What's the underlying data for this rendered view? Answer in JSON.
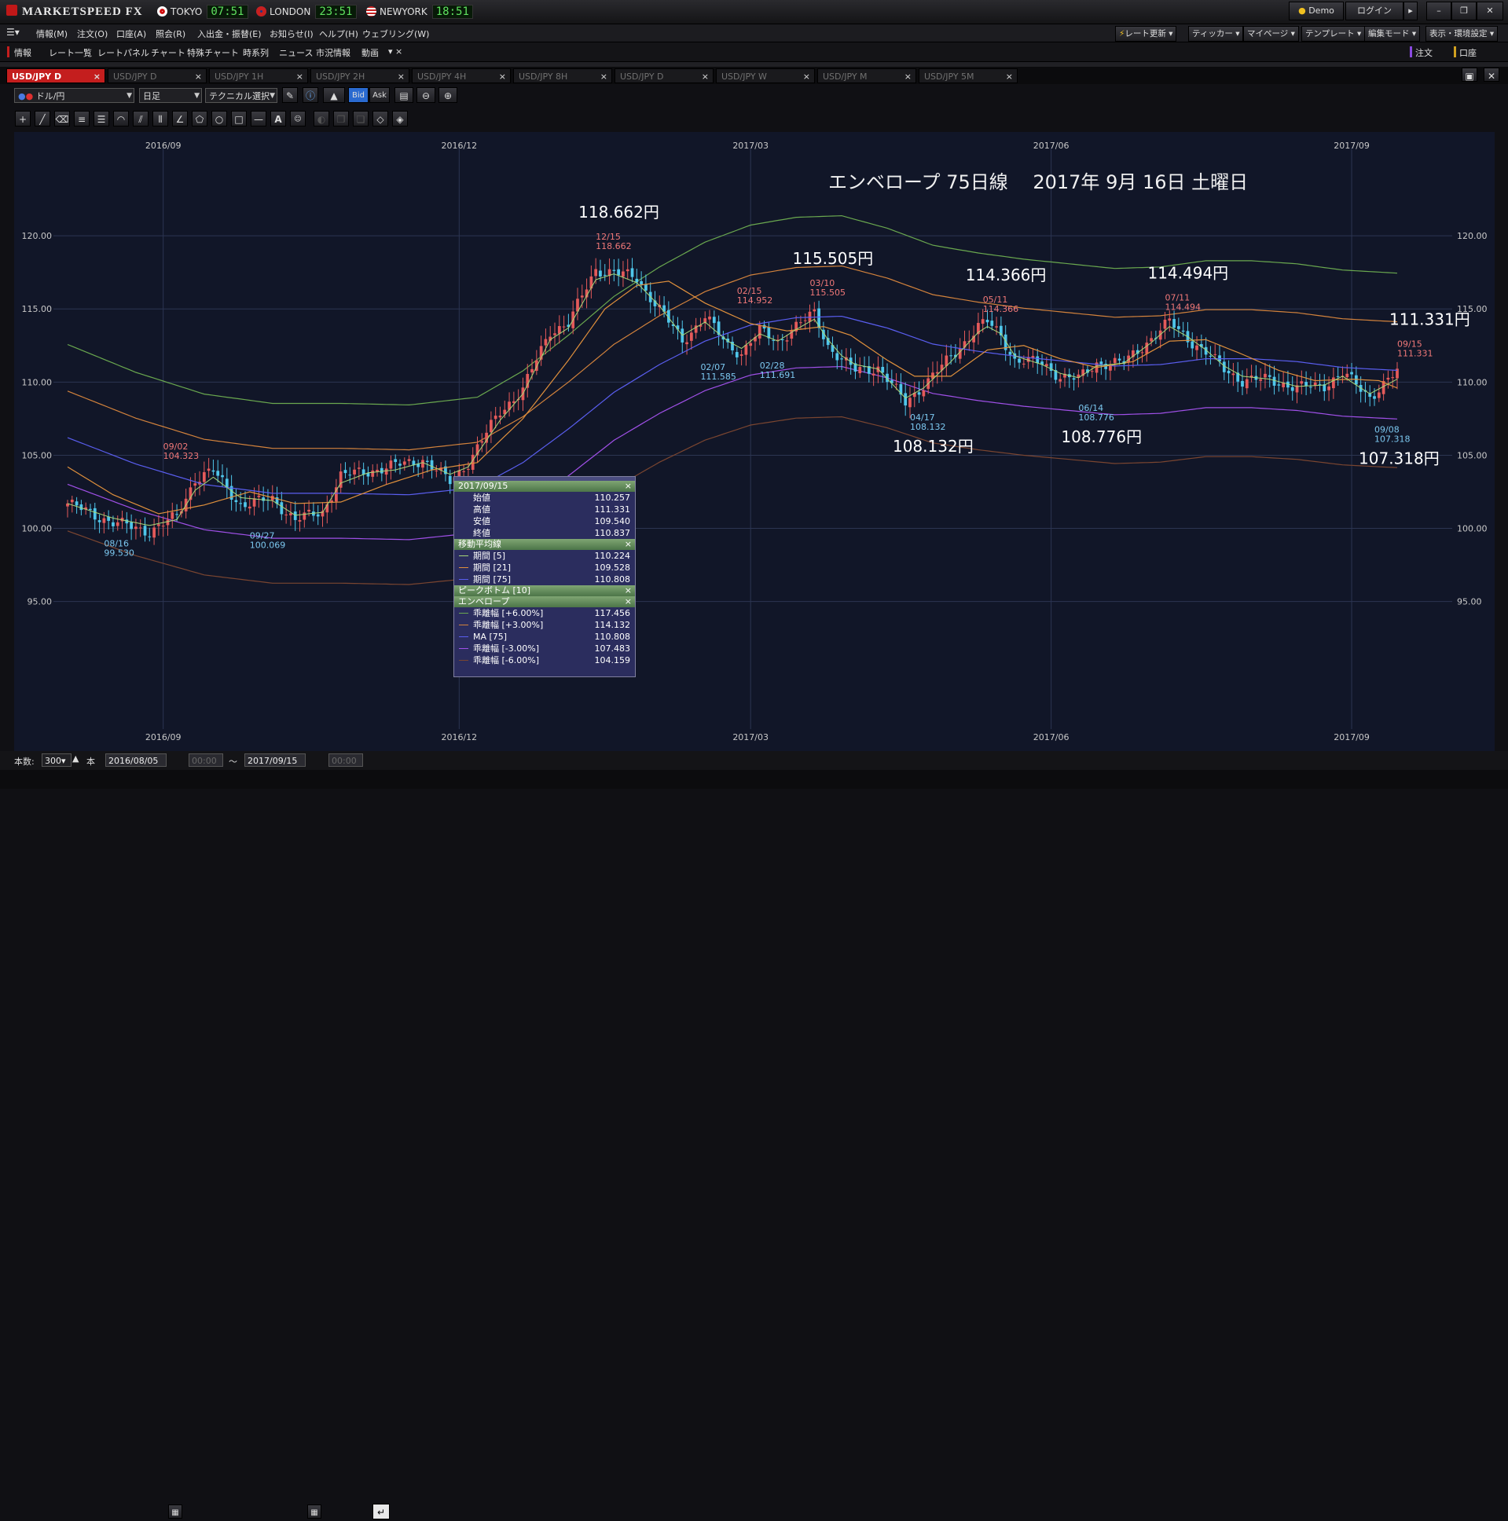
{
  "app": {
    "title": "MARKETSPEED FX",
    "markets": [
      {
        "name": "TOKYO",
        "time": "07:51",
        "flag_color": "#d01010"
      },
      {
        "name": "LONDON",
        "time": "23:51",
        "flag_color": "#1a3a8a"
      },
      {
        "name": "NEWYORK",
        "time": "18:51",
        "flag_color": "#2050a0"
      }
    ],
    "demo_label": "Demo",
    "login_label": "ログイン",
    "window_buttons": [
      "–",
      "❐",
      "✕"
    ]
  },
  "menu": {
    "items": [
      "情報(M)",
      "注文(O)",
      "口座(A)",
      "照会(R)",
      "入出金・振替(E)",
      "お知らせ(I)",
      "ヘルプ(H)",
      "ウェブリング(W)"
    ],
    "right_buttons": [
      "レート更新",
      "ティッカー",
      "マイページ",
      "テンプレート",
      "編集モード",
      "表示・環境設定"
    ]
  },
  "quickbar": {
    "items": [
      "情報",
      "レート一覧",
      "レートパネル",
      "チャート",
      "特殊チャート",
      "時系列",
      "ニュース",
      "市況情報",
      "動画"
    ],
    "right": [
      "注文",
      "口座"
    ]
  },
  "tabs": [
    {
      "label": "USD/JPY D",
      "active": true
    },
    {
      "label": "USD/JPY D"
    },
    {
      "label": "USD/JPY 1H"
    },
    {
      "label": "USD/JPY 2H"
    },
    {
      "label": "USD/JPY 4H"
    },
    {
      "label": "USD/JPY 8H"
    },
    {
      "label": "USD/JPY D"
    },
    {
      "label": "USD/JPY W"
    },
    {
      "label": "USD/JPY M"
    },
    {
      "label": "USD/JPY 5M"
    }
  ],
  "toolbar": {
    "pair": "ドル/円",
    "period": "日足",
    "technical": "テクニカル選択",
    "bid": "Bid",
    "ask": "Ask"
  },
  "chart_data": {
    "type": "candlestick",
    "title": "エンベロープ 75日線　 2017年 9月 16日 土曜日",
    "x_tick_labels": [
      "2016/09",
      "2016/12",
      "2017/03",
      "2017/06",
      "2017/09"
    ],
    "ylim": [
      93.8,
      122.8
    ],
    "y_ticks": [
      "95.00",
      "100.00",
      "105.00",
      "110.00",
      "115.00",
      "120.00"
    ],
    "grid": true,
    "colors": {
      "up": "#e45a5a",
      "down": "#4fc6ea",
      "ma5": "#a8d878",
      "ma21": "#e0903c",
      "ma75": "#5a5ef0",
      "env_p6": "#6aa84f",
      "env_p3": "#d2823c",
      "env_m3": "#a050e8",
      "env_m6": "#7a4530"
    },
    "peaks": [
      {
        "date": "12/15",
        "value": "118.662",
        "big": "118.662円",
        "type": "high"
      },
      {
        "date": "03/10",
        "value": "115.505",
        "big": "115.505円",
        "type": "high"
      },
      {
        "date": "05/11",
        "value": "114.366",
        "big": "114.366円",
        "type": "high"
      },
      {
        "date": "07/11",
        "value": "114.494",
        "big": "114.494円",
        "type": "high"
      },
      {
        "date": "09/15",
        "value": "111.331",
        "big": "111.331円",
        "type": "high"
      },
      {
        "date": "09/02",
        "value": "104.323",
        "type": "high"
      },
      {
        "date": "02/15",
        "value": "114.952",
        "type": "high"
      },
      {
        "date": "08/16",
        "value": "99.530",
        "type": "low"
      },
      {
        "date": "09/27",
        "value": "100.069",
        "type": "low"
      },
      {
        "date": "02/07",
        "value": "111.585",
        "type": "low"
      },
      {
        "date": "02/28",
        "value": "111.691",
        "type": "low"
      },
      {
        "date": "04/17",
        "value": "108.132",
        "big": "108.132円",
        "type": "low"
      },
      {
        "date": "06/14",
        "value": "108.776",
        "big": "108.776円",
        "type": "low"
      },
      {
        "date": "09/08",
        "value": "107.318",
        "big": "107.318円",
        "type": "low"
      }
    ],
    "series_anchors": {
      "close": [
        [
          0,
          101.7
        ],
        [
          10,
          100.4
        ],
        [
          18,
          99.8
        ],
        [
          24,
          100.8
        ],
        [
          28,
          103.4
        ],
        [
          32,
          103.9
        ],
        [
          38,
          101.6
        ],
        [
          45,
          102.0
        ],
        [
          50,
          100.6
        ],
        [
          56,
          101.1
        ],
        [
          60,
          103.6
        ],
        [
          66,
          103.9
        ],
        [
          72,
          104.3
        ],
        [
          78,
          104.7
        ],
        [
          84,
          103.2
        ],
        [
          88,
          104.5
        ],
        [
          95,
          108.0
        ],
        [
          100,
          109.5
        ],
        [
          106,
          113.5
        ],
        [
          110,
          114.0
        ],
        [
          116,
          117.7
        ],
        [
          120,
          117.5
        ],
        [
          125,
          117.1
        ],
        [
          130,
          115.0
        ],
        [
          135,
          112.8
        ],
        [
          140,
          114.5
        ],
        [
          145,
          112.5
        ],
        [
          148,
          112.0
        ],
        [
          152,
          113.5
        ],
        [
          156,
          112.8
        ],
        [
          160,
          113.8
        ],
        [
          164,
          114.7
        ],
        [
          167,
          112.5
        ],
        [
          170,
          111.5
        ],
        [
          173,
          110.8
        ],
        [
          178,
          111.0
        ],
        [
          184,
          108.6
        ],
        [
          188,
          109.8
        ],
        [
          194,
          111.7
        ],
        [
          200,
          113.8
        ],
        [
          202,
          114.1
        ],
        [
          205,
          113.2
        ],
        [
          208,
          111.5
        ],
        [
          214,
          111.3
        ],
        [
          218,
          110.4
        ],
        [
          222,
          110.2
        ],
        [
          226,
          111.3
        ],
        [
          232,
          111.3
        ],
        [
          238,
          113.0
        ],
        [
          242,
          114.1
        ],
        [
          246,
          113.0
        ],
        [
          250,
          112.0
        ],
        [
          254,
          110.9
        ],
        [
          258,
          110.1
        ],
        [
          264,
          110.2
        ],
        [
          270,
          109.6
        ],
        [
          276,
          109.8
        ],
        [
          280,
          110.6
        ],
        [
          286,
          109.0
        ],
        [
          292,
          110.7
        ]
      ]
    },
    "ma_anchors": {
      "ma5": [
        [
          0,
          101.7
        ],
        [
          10,
          100.7
        ],
        [
          18,
          100.2
        ],
        [
          24,
          100.6
        ],
        [
          28,
          102.6
        ],
        [
          32,
          103.5
        ],
        [
          38,
          102.1
        ],
        [
          45,
          101.9
        ],
        [
          50,
          100.9
        ],
        [
          56,
          101.1
        ],
        [
          60,
          103.1
        ],
        [
          66,
          103.8
        ],
        [
          72,
          104.0
        ],
        [
          78,
          104.5
        ],
        [
          84,
          103.7
        ],
        [
          88,
          104.2
        ],
        [
          95,
          107.4
        ],
        [
          100,
          109.2
        ],
        [
          106,
          112.9
        ],
        [
          110,
          113.7
        ],
        [
          116,
          117.0
        ],
        [
          120,
          117.4
        ],
        [
          125,
          116.8
        ],
        [
          130,
          115.2
        ],
        [
          135,
          113.2
        ],
        [
          140,
          114.1
        ],
        [
          145,
          112.8
        ],
        [
          148,
          112.3
        ],
        [
          152,
          113.3
        ],
        [
          156,
          112.8
        ],
        [
          160,
          113.6
        ],
        [
          164,
          114.3
        ],
        [
          167,
          112.9
        ],
        [
          170,
          111.8
        ],
        [
          173,
          111.2
        ],
        [
          178,
          110.9
        ],
        [
          184,
          108.9
        ],
        [
          188,
          109.6
        ],
        [
          194,
          111.4
        ],
        [
          200,
          113.4
        ],
        [
          202,
          113.8
        ],
        [
          205,
          113.3
        ],
        [
          208,
          111.8
        ],
        [
          214,
          111.2
        ],
        [
          218,
          110.6
        ],
        [
          222,
          110.3
        ],
        [
          226,
          111.1
        ],
        [
          232,
          111.3
        ],
        [
          238,
          112.7
        ],
        [
          242,
          113.8
        ],
        [
          246,
          113.1
        ],
        [
          250,
          112.2
        ],
        [
          254,
          111.1
        ],
        [
          258,
          110.4
        ],
        [
          264,
          110.2
        ],
        [
          270,
          109.7
        ],
        [
          276,
          109.8
        ],
        [
          280,
          110.4
        ],
        [
          286,
          109.2
        ],
        [
          292,
          110.2
        ]
      ],
      "ma21": [
        [
          0,
          104.2
        ],
        [
          10,
          102.3
        ],
        [
          20,
          101.0
        ],
        [
          30,
          101.6
        ],
        [
          40,
          102.5
        ],
        [
          50,
          101.7
        ],
        [
          60,
          101.8
        ],
        [
          70,
          103.0
        ],
        [
          80,
          104.0
        ],
        [
          90,
          104.5
        ],
        [
          100,
          107.5
        ],
        [
          110,
          111.5
        ],
        [
          118,
          115.0
        ],
        [
          125,
          116.6
        ],
        [
          132,
          116.9
        ],
        [
          140,
          115.4
        ],
        [
          150,
          114.0
        ],
        [
          158,
          113.5
        ],
        [
          166,
          113.8
        ],
        [
          172,
          113.2
        ],
        [
          180,
          111.5
        ],
        [
          186,
          110.4
        ],
        [
          194,
          110.4
        ],
        [
          202,
          112.2
        ],
        [
          210,
          112.5
        ],
        [
          218,
          111.6
        ],
        [
          226,
          111.0
        ],
        [
          234,
          111.4
        ],
        [
          242,
          112.8
        ],
        [
          250,
          112.9
        ],
        [
          258,
          111.9
        ],
        [
          266,
          110.8
        ],
        [
          274,
          110.1
        ],
        [
          282,
          110.2
        ],
        [
          288,
          110.1
        ],
        [
          292,
          109.6
        ]
      ],
      "ma75": [
        [
          0,
          106.2
        ],
        [
          15,
          104.4
        ],
        [
          30,
          103.0
        ],
        [
          45,
          102.4
        ],
        [
          60,
          102.4
        ],
        [
          75,
          102.3
        ],
        [
          90,
          102.8
        ],
        [
          100,
          104.5
        ],
        [
          110,
          106.8
        ],
        [
          120,
          109.3
        ],
        [
          130,
          111.2
        ],
        [
          140,
          112.8
        ],
        [
          150,
          113.9
        ],
        [
          160,
          114.4
        ],
        [
          170,
          114.5
        ],
        [
          180,
          113.7
        ],
        [
          190,
          112.6
        ],
        [
          200,
          112.1
        ],
        [
          210,
          111.7
        ],
        [
          220,
          111.4
        ],
        [
          230,
          111.1
        ],
        [
          240,
          111.2
        ],
        [
          250,
          111.6
        ],
        [
          260,
          111.6
        ],
        [
          270,
          111.4
        ],
        [
          280,
          111.0
        ],
        [
          292,
          110.8
        ]
      ]
    },
    "info_panel": {
      "date": "2017/09/15",
      "ohlc": [
        [
          "始値",
          "110.257"
        ],
        [
          "高値",
          "111.331"
        ],
        [
          "安値",
          "109.540"
        ],
        [
          "終値",
          "110.837"
        ]
      ],
      "ma_title": "移動平均線",
      "ma": [
        [
          "期間 [5]",
          "110.224"
        ],
        [
          "期間 [21]",
          "109.528"
        ],
        [
          "期間 [75]",
          "110.808"
        ]
      ],
      "peak_title": "ピークボトム [10]",
      "env_title": "エンベロープ",
      "env": [
        [
          "乖離幅 [+6.00%]",
          "117.456"
        ],
        [
          "乖離幅 [+3.00%]",
          "114.132"
        ],
        [
          "MA [75]",
          "110.808"
        ],
        [
          "乖離幅 [-3.00%]",
          "107.483"
        ],
        [
          "乖離幅 [-6.00%]",
          "104.159"
        ]
      ]
    }
  },
  "bottom": {
    "count_label": "本数:",
    "count": "300",
    "unit": "本",
    "from_date": "2016/08/05",
    "from_time": "00:00",
    "tilde": "〜",
    "to_date": "2017/09/15",
    "to_time": "00:00"
  }
}
